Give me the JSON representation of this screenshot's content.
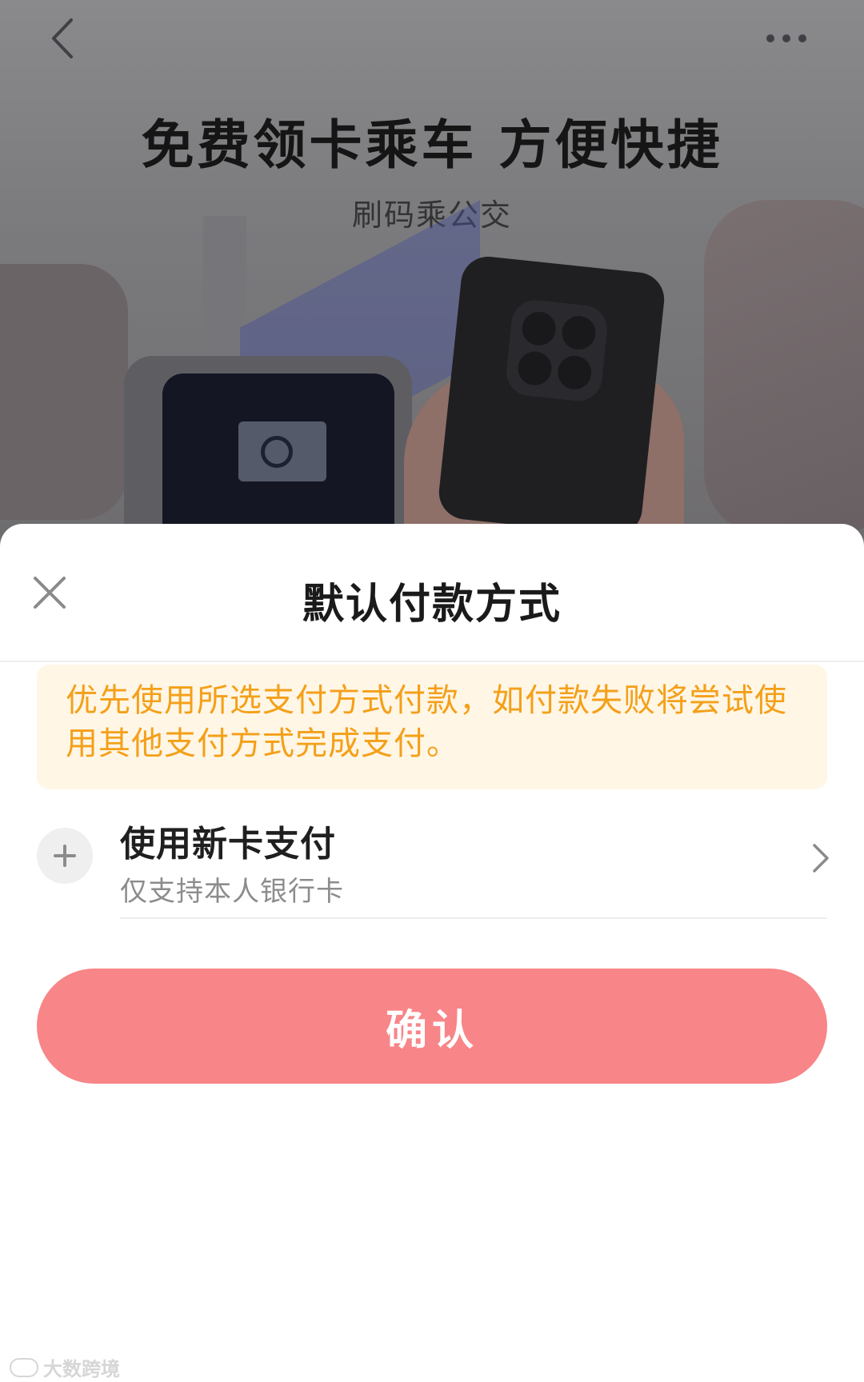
{
  "background": {
    "title": "免费领卡乘车 方便快捷",
    "subtitle": "刷码乘公交",
    "icons": {
      "back": "chevron-left-icon",
      "more": "more-dots-icon"
    }
  },
  "sheet": {
    "title": "默认付款方式",
    "close_icon": "close-icon",
    "notice": "优先使用所选支付方式付款，如付款失败将尝试使用其他支付方式完成支付。",
    "add_card": {
      "title": "使用新卡支付",
      "subtitle": "仅支持本人银行卡",
      "icon": "plus-icon",
      "chevron": "chevron-right-icon"
    },
    "confirm_label": "确认"
  },
  "watermark": {
    "text": "大数跨境"
  },
  "colors": {
    "accent": "#f88588",
    "notice_text": "#f4a019",
    "notice_bg": "#fff6e6"
  }
}
